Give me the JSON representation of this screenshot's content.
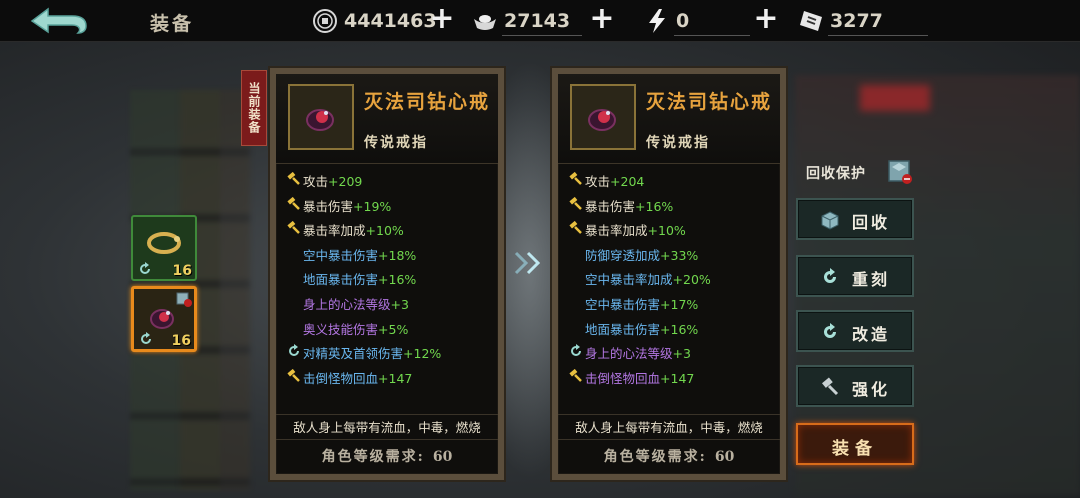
{
  "header": {
    "title": "装备",
    "resources": [
      {
        "icon": "coin-icon",
        "value": "4441463"
      },
      {
        "icon": "silver-ingot-icon",
        "value": "27143"
      },
      {
        "icon": "lightning-icon",
        "value": "0"
      },
      {
        "icon": "ticket-icon",
        "value": "3277"
      }
    ]
  },
  "inventory": [
    {
      "item": "bracelet",
      "level": "16"
    },
    {
      "item": "ring",
      "level": "16"
    }
  ],
  "current_tag": "当前装备",
  "current_item": {
    "name": "灭法司钻心戒",
    "type": "传说戒指",
    "stats": [
      {
        "marker": "hammer",
        "name": "攻击",
        "value": "+209",
        "color": "white"
      },
      {
        "marker": "hammer",
        "name": "暴击伤害",
        "value": "+19%",
        "color": "white"
      },
      {
        "marker": "hammer",
        "name": "暴击率加成",
        "value": "+10%",
        "color": "white"
      },
      {
        "marker": "none",
        "name": "空中暴击伤害",
        "value": "+18%",
        "color": "blue"
      },
      {
        "marker": "none",
        "name": "地面暴击伤害",
        "value": "+16%",
        "color": "blue"
      },
      {
        "marker": "none",
        "name": "身上的心法等级",
        "value": "+3",
        "color": "purple"
      },
      {
        "marker": "none",
        "name": "奥义技能伤害",
        "value": "+5%",
        "color": "purple"
      },
      {
        "marker": "recast",
        "name": "对精英及首领伤害",
        "value": "+12%",
        "color": "blue"
      },
      {
        "marker": "hammer",
        "name": "击倒怪物回血",
        "value": "+147",
        "color": "blue"
      }
    ],
    "effect": "敌人身上每带有流血，中毒，燃烧",
    "requirement_label": "角色等级需求:",
    "requirement_value": "60"
  },
  "new_item": {
    "name": "灭法司钻心戒",
    "type": "传说戒指",
    "stats": [
      {
        "marker": "hammer",
        "name": "攻击",
        "value": "+204",
        "color": "white"
      },
      {
        "marker": "hammer",
        "name": "暴击伤害",
        "value": "+16%",
        "color": "white"
      },
      {
        "marker": "hammer",
        "name": "暴击率加成",
        "value": "+10%",
        "color": "white"
      },
      {
        "marker": "none",
        "name": "防御穿透加成",
        "value": "+33%",
        "color": "blue"
      },
      {
        "marker": "none",
        "name": "空中暴击率加成",
        "value": "+20%",
        "color": "blue"
      },
      {
        "marker": "none",
        "name": "空中暴击伤害",
        "value": "+17%",
        "color": "blue"
      },
      {
        "marker": "none",
        "name": "地面暴击伤害",
        "value": "+16%",
        "color": "blue"
      },
      {
        "marker": "recast",
        "name": "身上的心法等级",
        "value": "+3",
        "color": "purple"
      },
      {
        "marker": "hammer",
        "name": "击倒怪物回血",
        "value": "+147",
        "color": "purple"
      }
    ],
    "effect": "敌人身上每带有流血，中毒，燃烧",
    "requirement_label": "角色等级需求:",
    "requirement_value": "60"
  },
  "actions": {
    "protect_label": "回收保护",
    "recycle": "回收",
    "recast": "重刻",
    "reform": "改造",
    "enhance": "强化",
    "equip": "装备"
  },
  "colors": {
    "legendary_name": "#e7a33e",
    "stat_value": "#72d84e",
    "stat_blue": "#6ab7ef",
    "stat_purple": "#b377e3",
    "equip_glow": "#d86c1a"
  }
}
